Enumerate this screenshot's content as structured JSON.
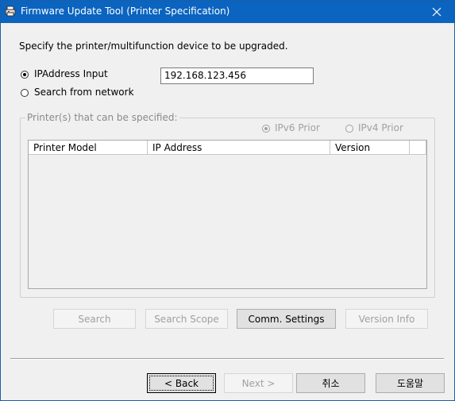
{
  "window": {
    "title": "Firmware Update Tool (Printer Specification)"
  },
  "instruction": "Specify the printer/multifunction device to be upgraded.",
  "mode": {
    "ip_input": {
      "label": "IPAddress Input",
      "checked": true
    },
    "search_network": {
      "label": "Search from network",
      "checked": false
    }
  },
  "ip_field": {
    "value": "192.168.123.456"
  },
  "group": {
    "legend": "Printer(s) that can be specified:",
    "ipv6_prior": {
      "label": "IPv6 Prior",
      "checked": true
    },
    "ipv4_prior": {
      "label": "IPv4 Prior",
      "checked": false
    }
  },
  "table": {
    "columns": [
      "Printer Model",
      "IP Address",
      "Version"
    ],
    "rows": []
  },
  "actions": {
    "search": "Search",
    "search_scope": "Search Scope",
    "comm_settings": "Comm. Settings",
    "version_info": "Version Info"
  },
  "footer": {
    "back": "< Back",
    "next": "Next >",
    "cancel": "취소",
    "help": "도움말"
  }
}
